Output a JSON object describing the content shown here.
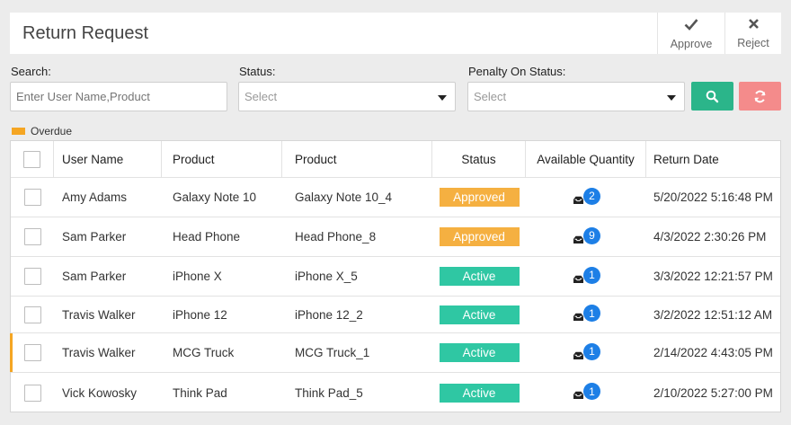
{
  "header": {
    "title": "Return Request",
    "approve_label": "Approve",
    "reject_label": "Reject"
  },
  "filters": {
    "search_label": "Search:",
    "search_placeholder": "Enter User Name,Product",
    "status_label": "Status:",
    "status_value": "Select",
    "penalty_label": "Penalty On Status:",
    "penalty_value": "Select"
  },
  "legend": {
    "overdue_label": "Overdue",
    "overdue_color": "#f5a623"
  },
  "colors": {
    "approved": "#f5b041",
    "active": "#2fc7a3",
    "accent_blue": "#1d7fe6",
    "search_btn": "#2bb58a",
    "reset_btn": "#f48b8b"
  },
  "table": {
    "columns": [
      "User Name",
      "Product",
      "Product",
      "Status",
      "Available Quantity",
      "Return Date"
    ],
    "rows": [
      {
        "user": "Amy Adams",
        "product": "Galaxy Note 10",
        "product_variant": "Galaxy Note 10_4",
        "status": "Approved",
        "quantity": "2",
        "return_date": "5/20/2022 5:16:48 PM",
        "overdue": false
      },
      {
        "user": "Sam Parker",
        "product": "Head Phone",
        "product_variant": "Head Phone_8",
        "status": "Approved",
        "quantity": "9",
        "return_date": "4/3/2022 2:30:26 PM",
        "overdue": false
      },
      {
        "user": "Sam Parker",
        "product": "iPhone X",
        "product_variant": "iPhone X_5",
        "status": "Active",
        "quantity": "1",
        "return_date": "3/3/2022 12:21:57 PM",
        "overdue": false
      },
      {
        "user": "Travis Walker",
        "product": "iPhone 12",
        "product_variant": "iPhone 12_2",
        "status": "Active",
        "quantity": "1",
        "return_date": "3/2/2022 12:51:12 AM",
        "overdue": false
      },
      {
        "user": "Travis Walker",
        "product": "MCG Truck",
        "product_variant": "MCG Truck_1",
        "status": "Active",
        "quantity": "1",
        "return_date": "2/14/2022 4:43:05 PM",
        "overdue": true
      },
      {
        "user": "Vick Kowosky",
        "product": "Think Pad",
        "product_variant": "Think Pad_5",
        "status": "Active",
        "quantity": "1",
        "return_date": "2/10/2022 5:27:00 PM",
        "overdue": false
      }
    ]
  }
}
